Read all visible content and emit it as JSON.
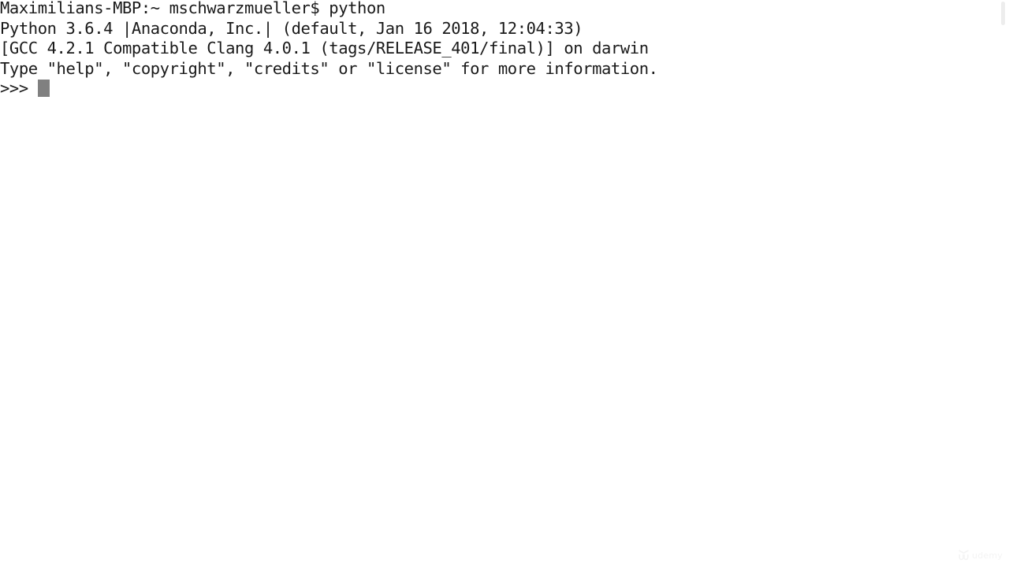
{
  "terminal": {
    "background_color": "#ffffff",
    "text_color": "#1a1a1a",
    "cursor_color": "#808080",
    "lines": [
      "Maximilians-MBP:~ mschwarzmueller$ python",
      "Python 3.6.4 |Anaconda, Inc.| (default, Jan 16 2018, 12:04:33)",
      "[GCC 4.2.1 Compatible Clang 4.0.1 (tags/RELEASE_401/final)] on darwin",
      "Type \"help\", \"copyright\", \"credits\" or \"license\" for more information."
    ],
    "prompt": ">>> ",
    "current_input": ""
  },
  "watermark": {
    "label": "udemy"
  }
}
